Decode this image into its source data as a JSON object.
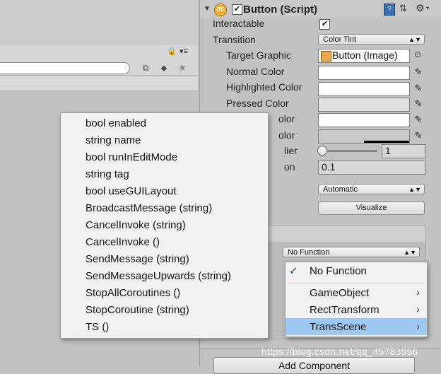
{
  "component": {
    "title": "Button (Script)",
    "enabled_check": "✔"
  },
  "inspector": {
    "interactable_label": "Interactable",
    "interactable_check": "✔",
    "transition_label": "Transition",
    "transition_value": "Color Tint",
    "target_graphic_label": "Target Graphic",
    "target_graphic_value": "Button (Image)",
    "normal_color_label": "Normal Color",
    "highlighted_color_label": "Highlighted Color",
    "pressed_color_label": "Pressed Color",
    "disabled_color_label_partial": "olor",
    "selected_color_label_partial": "olor",
    "color_multiplier_label_partial": "lier",
    "color_multiplier_value": "1",
    "fade_duration_label_partial": "on",
    "fade_duration_value": "0.1",
    "navigation_value": "Automatic",
    "visualize_label": "Visualize",
    "function_dropdown_value": "No Function",
    "add_component_label": "Add Component"
  },
  "context_menu": {
    "items": [
      "bool enabled",
      "string name",
      "bool runInEditMode",
      "string tag",
      "bool useGUILayout",
      "BroadcastMessage (string)",
      "CancelInvoke (string)",
      "CancelInvoke ()",
      "SendMessage (string)",
      "SendMessageUpwards (string)",
      "StopAllCoroutines ()",
      "StopCoroutine (string)",
      "TS ()"
    ]
  },
  "sub_menu": {
    "check": "✓",
    "no_function": "No Function",
    "items": [
      "GameObject",
      "RectTransform",
      "TransScene"
    ],
    "selected": "TransScene"
  },
  "watermark": "https://blog.csdn.net/qq_45783556",
  "colors": {
    "panel": "#c2c2c2",
    "menu_bg": "#f2f2f2",
    "selection": "#9ec8ef"
  }
}
